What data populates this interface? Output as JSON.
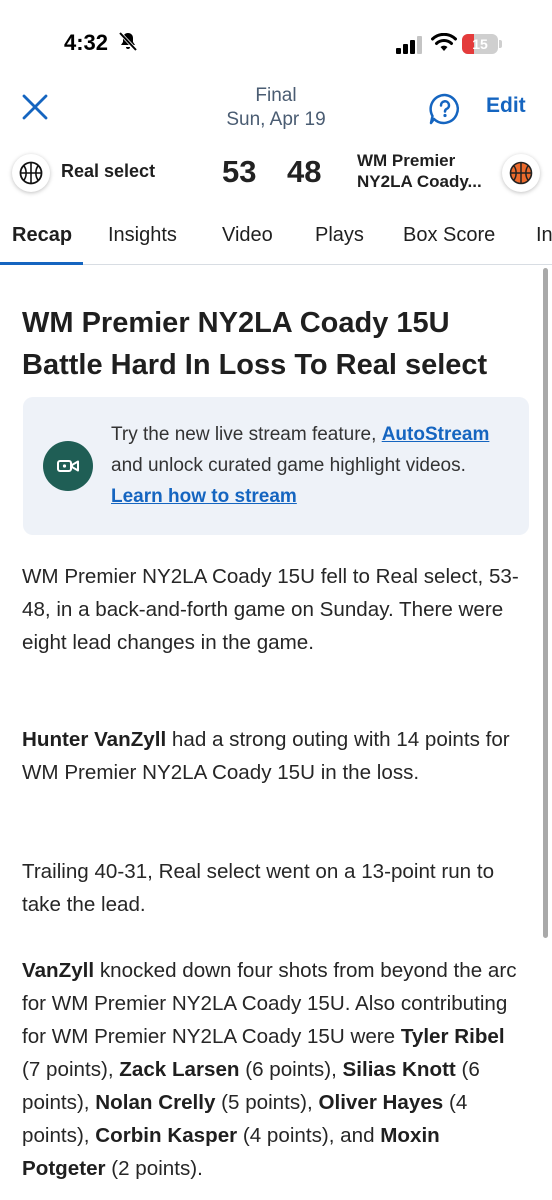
{
  "status_bar": {
    "time": "4:32",
    "battery": "15",
    "battery_level": 0.15
  },
  "header": {
    "status": "Final",
    "date": "Sun, Apr 19",
    "edit_label": "Edit"
  },
  "scoreboard": {
    "home": {
      "name": "Real select",
      "score": "53"
    },
    "away": {
      "name_line1": "WM Premier",
      "name_line2": "NY2LA Coady...",
      "score": "48"
    }
  },
  "tabs": [
    {
      "label": "Recap"
    },
    {
      "label": "Insights"
    },
    {
      "label": "Video"
    },
    {
      "label": "Plays"
    },
    {
      "label": "Box Score"
    },
    {
      "label": "In"
    }
  ],
  "article": {
    "headline": "WM Premier NY2LA Coady 15U Battle Hard In Loss To Real select",
    "promo": {
      "text_1": "Try the new live stream feature, ",
      "link_1": "AutoStream",
      "text_2": " and unlock curated game highlight videos. ",
      "link_2": "Learn how to stream"
    },
    "paragraph_1": "WM Premier NY2LA Coady 15U fell to Real select, 53-48, in a back-and-forth game on Sunday. There were eight lead changes in the game.",
    "paragraph_2": {
      "name": "Hunter VanZyll",
      "text": " had a strong outing with 14 points for WM Premier NY2LA Coady 15U in the loss."
    },
    "paragraph_3": "Trailing 40-31, Real select went on a 13-point run to take the lead.",
    "paragraph_4": {
      "p1": "VanZyll",
      "t1": " knocked down four shots from beyond the arc for WM Premier NY2LA Coady 15U. Also contributing for WM Premier NY2LA Coady 15U were ",
      "p2": "Tyler Ribel",
      "t2": " (7 points), ",
      "p3": "Zack Larsen",
      "t3": " (6 points), ",
      "p4": "Silias Knott",
      "t4": " (6 points), ",
      "p5": "Nolan Crelly",
      "t5": " (5 points), ",
      "p6": "Oliver Hayes",
      "t6": " (4 points), ",
      "p7": "Corbin Kasper",
      "t7": " (4 points), and ",
      "p8": "Moxin Potgeter",
      "t8": " (2 points)."
    }
  },
  "colors": {
    "accent": "#1565c0",
    "header_text": "#4a5c72",
    "promo_bg": "#eef2f8",
    "promo_icon_bg": "#1f5e55",
    "battery_low": "#e43b3b"
  },
  "icons": {
    "close": "close-icon",
    "help": "help-icon",
    "home_team": "basketball-icon",
    "away_team": "basketball-icon",
    "promo": "video-camera-icon",
    "mute": "bell-slash-icon"
  }
}
